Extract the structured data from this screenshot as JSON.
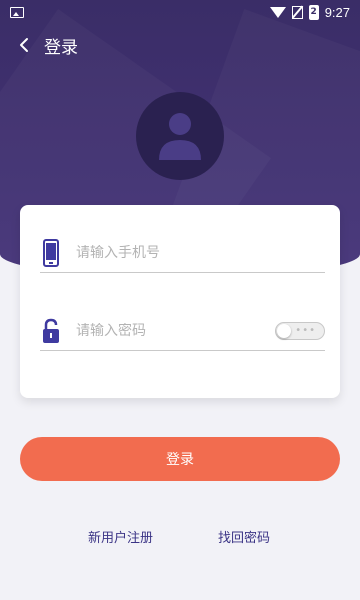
{
  "status_bar": {
    "time": "9:27",
    "battery_level": "2"
  },
  "header": {
    "title": "登录",
    "back_icon": "chevron-left-icon"
  },
  "avatar": {
    "icon": "user-icon"
  },
  "form": {
    "phone": {
      "placeholder": "请输入手机号",
      "value": "",
      "icon": "phone-icon"
    },
    "password": {
      "placeholder": "请输入密码",
      "value": "",
      "icon": "lock-icon",
      "show_password": false
    }
  },
  "actions": {
    "login_label": "登录",
    "register_label": "新用户注册",
    "forgot_label": "找回密码"
  },
  "colors": {
    "header_bg": "#3a2d67",
    "accent_icon": "#3f3aa0",
    "login_button": "#f26c4f",
    "link_text": "#3b3486"
  }
}
